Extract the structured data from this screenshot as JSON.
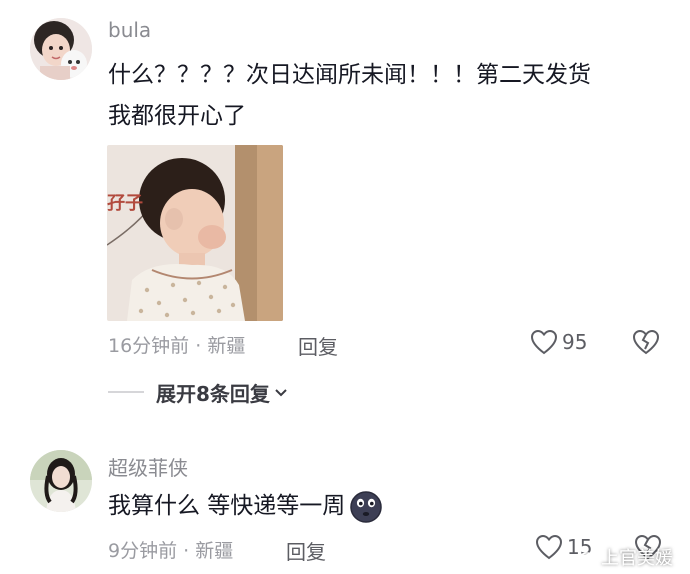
{
  "comments": [
    {
      "username": "bula",
      "text_line1": "什么？？？？次日达闻所未闻！！！第二天发货",
      "text_line2": "我都很开心了",
      "time": "16分钟前",
      "separator": "·",
      "location": "新疆",
      "reply_label": "回复",
      "likes": "95",
      "expand_replies": "展开8条回复"
    },
    {
      "username": "超级菲侠",
      "text": "我算什么 等快递等一周",
      "time": "9分钟前",
      "separator": "·",
      "location": "新疆",
      "reply_label": "回复",
      "likes": "15"
    }
  ],
  "attached_image_text": "孖子",
  "watermark": "上官美媛",
  "icons": [
    "avatar",
    "heart-icon",
    "broken-heart-icon",
    "chevron-down-icon",
    "emoji-icon",
    "weibo-icon"
  ],
  "colors": {
    "text": "#161823",
    "meta": "#9a9ba1",
    "username": "#8a8b91"
  }
}
